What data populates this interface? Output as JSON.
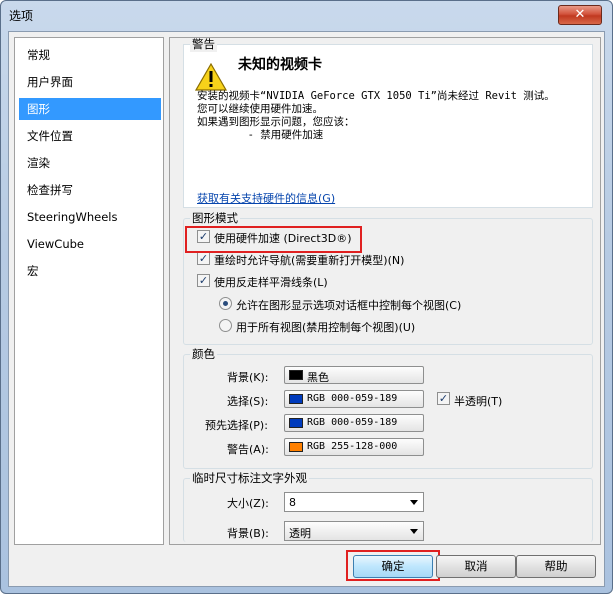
{
  "window": {
    "title": "选项",
    "close_glyph": "✕"
  },
  "sidebar": {
    "items": [
      {
        "label": "常规",
        "selected": false
      },
      {
        "label": "用户界面",
        "selected": false
      },
      {
        "label": "图形",
        "selected": true
      },
      {
        "label": "文件位置",
        "selected": false
      },
      {
        "label": "渲染",
        "selected": false
      },
      {
        "label": "检查拼写",
        "selected": false
      },
      {
        "label": "SteeringWheels",
        "selected": false
      },
      {
        "label": "ViewCube",
        "selected": false
      },
      {
        "label": "宏",
        "selected": false
      }
    ]
  },
  "warning": {
    "group_title": "警告",
    "heading": "未知的视频卡",
    "icon": "warning-triangle-icon",
    "lines": [
      "安装的视频卡“NVIDIA GeForce GTX 1050 Ti”尚未经过 Revit 测试。",
      "您可以继续使用硬件加速。",
      "如果遇到图形显示问题，您应该：",
      "        - 禁用硬件加速"
    ],
    "link": "获取有关支持硬件的信息(G)"
  },
  "graphics_mode": {
    "title": "图形模式",
    "hw_accel": {
      "label": "使用硬件加速 (Direct3D®)",
      "checked": true
    },
    "nav_redraw": {
      "label": "重绘时允许导航(需要重新打开模型)(N)",
      "checked": true
    },
    "anti_alias": {
      "label": "使用反走样平滑线条(L)",
      "checked": true
    },
    "radio_per_view": {
      "label": "允许在图形显示选项对话框中控制每个视图(C)",
      "selected": true
    },
    "radio_all_views": {
      "label": "用于所有视图(禁用控制每个视图)(U)",
      "selected": false
    }
  },
  "colors": {
    "title": "颜色",
    "background": {
      "label": "背景(K):",
      "value": "黑色",
      "color": "#000000"
    },
    "selection": {
      "label": "选择(S):",
      "value": "RGB 000-059-189",
      "color": "#003bbd"
    },
    "translucent": {
      "label": "半透明(T)",
      "checked": true
    },
    "preselection": {
      "label": "预先选择(P):",
      "value": "RGB 000-059-189",
      "color": "#003bbd"
    },
    "alert": {
      "label": "警告(A):",
      "value": "RGB 255-128-000",
      "color": "#ff8000"
    }
  },
  "temp_dim": {
    "title": "临时尺寸标注文字外观",
    "size": {
      "label": "大小(Z):",
      "value": "8"
    },
    "background": {
      "label": "背景(B):",
      "value": "透明"
    }
  },
  "buttons": {
    "ok": "确定",
    "cancel": "取消",
    "help": "帮助"
  }
}
